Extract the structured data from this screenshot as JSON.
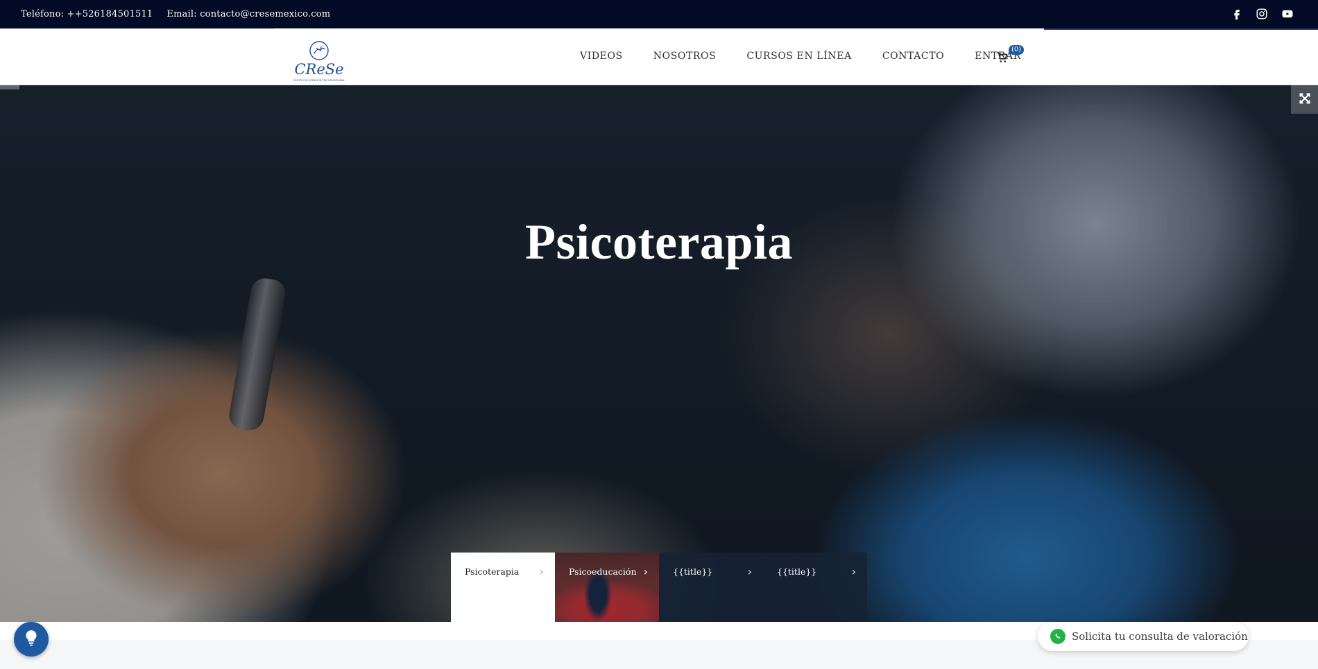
{
  "topbar": {
    "phone": "Teléfono: ++526184501511",
    "email": "Email: contacto@cresemexico.com",
    "social": [
      "facebook-icon",
      "instagram-icon",
      "youtube-icon"
    ]
  },
  "header": {
    "logo_text": "CReSe",
    "logo_tagline": "CENTRO DE ATENCIÓN PSICOEMOCIONAL",
    "nav": [
      "VIDEOS",
      "NOSOTROS",
      "CURSOS EN LÍNEA",
      "CONTACTO",
      "ENTRAR"
    ],
    "cart_count": "(0)"
  },
  "hero": {
    "title": "Psicoterapia"
  },
  "slider_tabs": [
    {
      "label": "Psicoterapia",
      "state": "active"
    },
    {
      "label": "Psicoeducación",
      "state": "image"
    },
    {
      "label": "{{title}}",
      "state": "dark"
    },
    {
      "label": "{{title}}",
      "state": "dark"
    }
  ],
  "whatsapp": {
    "label": "Solicita tu consulta de valoración"
  },
  "colors": {
    "topbar_bg": "#020a25",
    "accent_blue": "#1f5aa0",
    "whatsapp_green": "#25b245"
  }
}
